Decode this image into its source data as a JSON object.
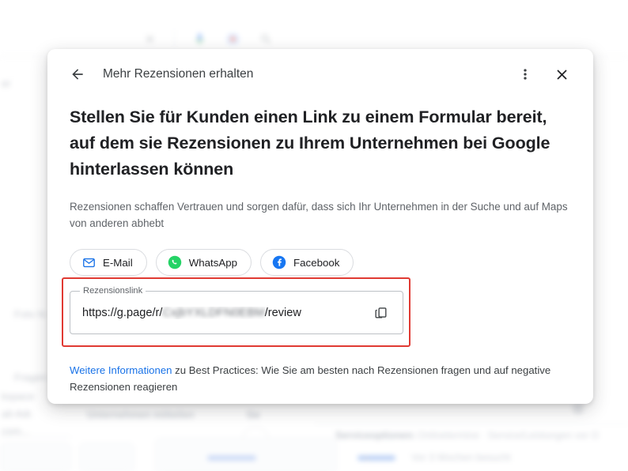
{
  "background": {
    "search_icons": [
      "close-icon",
      "microphone-icon",
      "google-lens-icon",
      "search-icon"
    ],
    "left_labels": [
      "er",
      "Foto hi",
      "Fragen",
      "se"
    ],
    "bottom_labels": {
      "workspace": "kspace",
      "email_label": "ail-Adr.",
      "email_value": "com...",
      "share_business": "Unternehmen mitteilen",
      "ge": "Ge",
      "service_options_label": "Serviceoptionen:",
      "service_options_value": "Onlinetermine · Service/Leistungen vor O",
      "visited": "Vor 3 Wochen besucht"
    },
    "next_arrow": "›"
  },
  "dialog": {
    "back_label": "back-arrow",
    "title": "Mehr Rezensionen erhalten",
    "more_menu": "more-options",
    "close": "close",
    "headline": "Stellen Sie für Kunden einen Link zu einem Formular bereit, auf dem sie Rezensionen zu Ihrem Unternehmen bei Google hinterlassen können",
    "subtext": "Rezensionen schaffen Vertrauen und sorgen dafür, dass sich Ihr Unternehmen in der Suche und auf Maps von anderen abhebt",
    "share_options": [
      {
        "label": "E-Mail",
        "icon": "email-icon",
        "color": "#1a73e8"
      },
      {
        "label": "WhatsApp",
        "icon": "whatsapp-icon",
        "color": "#25D366"
      },
      {
        "label": "Facebook",
        "icon": "facebook-icon",
        "color": "#1877F2"
      }
    ],
    "link_field": {
      "label": "Rezensionslink",
      "url_prefix": "https://g.page/r/",
      "url_redacted": "CxjbYXLDFN0EBM",
      "url_suffix": "/review",
      "copy_action": "copy-link"
    },
    "footnote": {
      "link_text": "Weitere Informationen",
      "rest": " zu Best Practices: Wie Sie am besten nach Rezensionen fragen und auf negative Rezensionen reagieren"
    }
  },
  "annotation": {
    "highlight_color": "#e03a33"
  }
}
